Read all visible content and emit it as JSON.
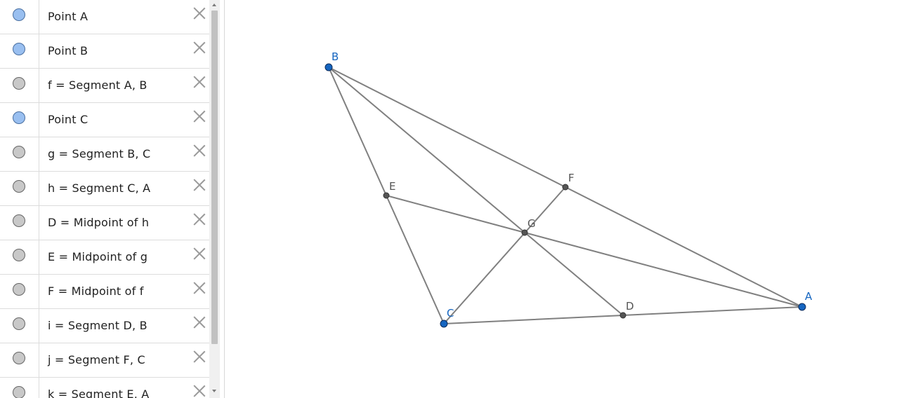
{
  "algebra": {
    "items": [
      {
        "label": "Point A",
        "visible": true
      },
      {
        "label": "Point B",
        "visible": true
      },
      {
        "label": "f = Segment A, B",
        "visible": false
      },
      {
        "label": "Point C",
        "visible": true
      },
      {
        "label": "g = Segment B, C",
        "visible": false
      },
      {
        "label": "h = Segment C, A",
        "visible": false
      },
      {
        "label": "D = Midpoint of h",
        "visible": false
      },
      {
        "label": "E = Midpoint of g",
        "visible": false
      },
      {
        "label": "F = Midpoint of f",
        "visible": false
      },
      {
        "label": "i = Segment D, B",
        "visible": false
      },
      {
        "label": "j = Segment F, C",
        "visible": false
      },
      {
        "label": "k = Segment E, A",
        "visible": false
      }
    ]
  },
  "graphics": {
    "labels": {
      "A": "A",
      "B": "B",
      "C": "C",
      "D": "D",
      "E": "E",
      "F": "F",
      "G": "G"
    },
    "colors": {
      "free_point": "#1565c0",
      "free_point_label": "#1565c0",
      "dependent_point": "#555555",
      "dependent_label": "#555555",
      "segment": "#808080"
    }
  }
}
